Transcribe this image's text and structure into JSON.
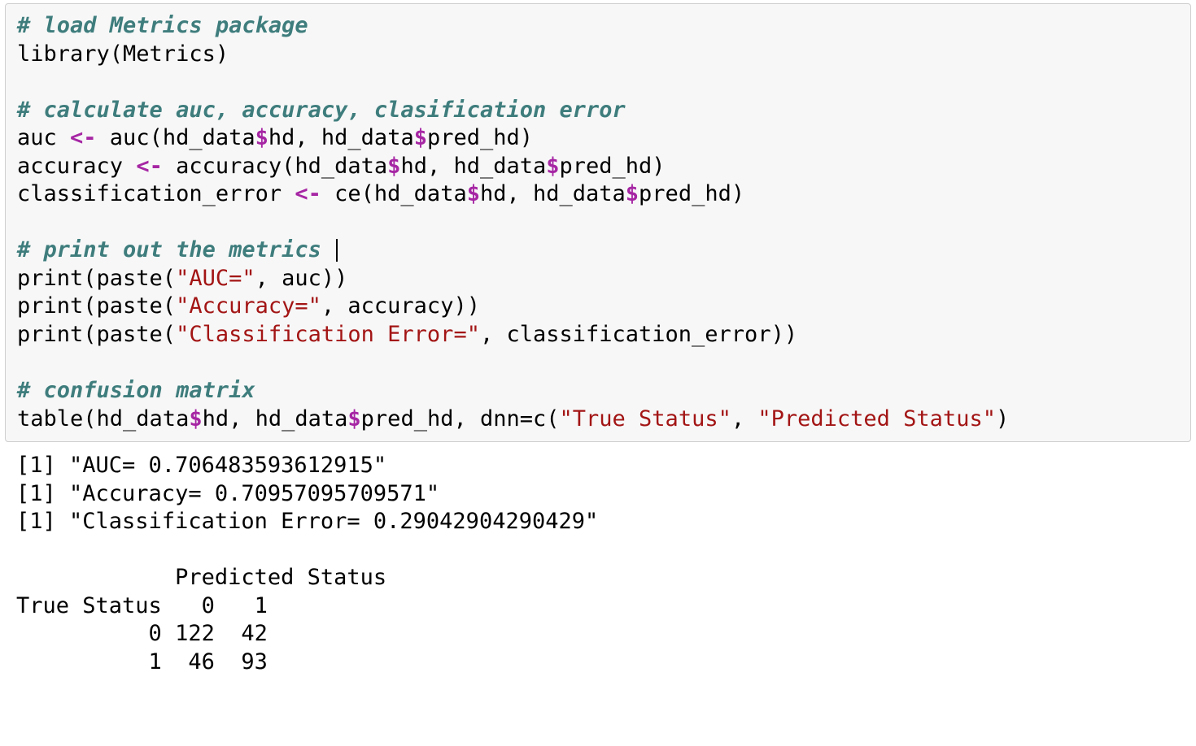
{
  "code": {
    "c1": "# load Metrics package",
    "l1a": "library(Metrics)",
    "blank": " ",
    "c2": "# calculate auc, accuracy, clasification error",
    "l_auc_a": "auc ",
    "assign": "<-",
    "l_auc_b": " auc(hd_data",
    "dollar": "$",
    "l_auc_c": "hd, hd_data",
    "l_auc_d": "pred_hd)",
    "l_acc_a": "accuracy ",
    "l_acc_b": " accuracy(hd_data",
    "l_acc_c": "hd, hd_data",
    "l_acc_d": "pred_hd)",
    "l_ce_a": "classification_error ",
    "l_ce_b": " ce(hd_data",
    "l_ce_c": "hd, hd_data",
    "l_ce_d": "pred_hd)",
    "c3": "# print out the metrics ",
    "l_p1_a": "print(paste(",
    "str_auc": "\"AUC=\"",
    "l_p1_b": ", auc))",
    "l_p2_a": "print(paste(",
    "str_acc": "\"Accuracy=\"",
    "l_p2_b": ", accuracy))",
    "l_p3_a": "print(paste(",
    "str_ce": "\"Classification Error=\"",
    "l_p3_b": ", classification_error))",
    "c4": "# confusion matrix",
    "l_t_a": "table(hd_data",
    "l_t_b": "hd, hd_data",
    "l_t_c": "pred_hd, dnn=c(",
    "str_ts": "\"True Status\"",
    "l_t_d": ", ",
    "str_ps": "\"Predicted Status\"",
    "l_t_e": ")"
  },
  "output": {
    "o1": "[1] \"AUC= 0.706483593612915\"",
    "o2": "[1] \"Accuracy= 0.70957095709571\"",
    "o3": "[1] \"Classification Error= 0.29042904290429\"",
    "t_hdr": "            Predicted Status",
    "t_cols": "True Status   0   1",
    "t_r0": "          0 122  42",
    "t_r1": "          1  46  93"
  },
  "chart_data": {
    "type": "table",
    "title": "Confusion matrix",
    "row_label": "True Status",
    "col_label": "Predicted Status",
    "categories": [
      "0",
      "1"
    ],
    "matrix": [
      [
        122,
        42
      ],
      [
        46,
        93
      ]
    ],
    "metrics": {
      "AUC": 0.706483593612915,
      "Accuracy": 0.70957095709571,
      "Classification Error": 0.29042904290429
    }
  }
}
